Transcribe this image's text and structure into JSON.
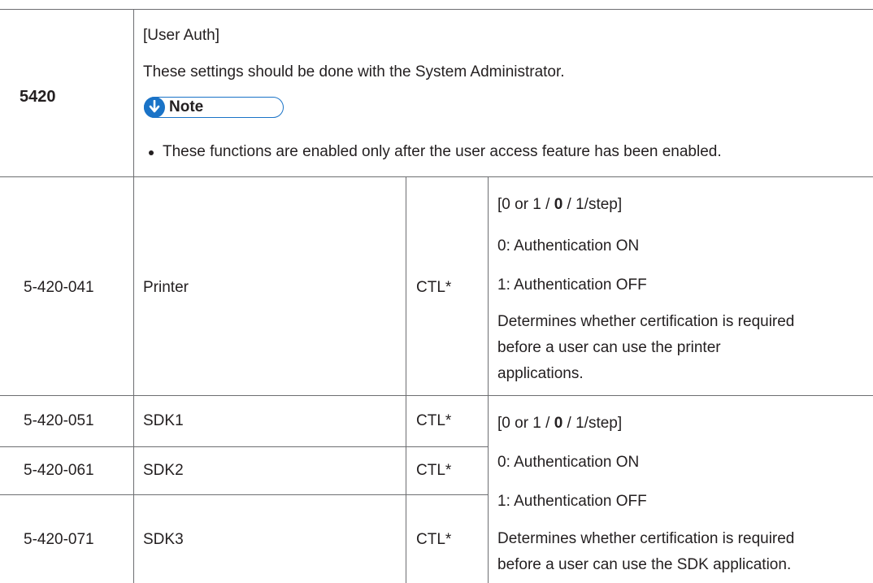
{
  "header": {
    "code": "5420",
    "title": "[User Auth]",
    "description": "These settings should be done with the System Administrator.",
    "note_label": "Note",
    "note_item": "These functions are enabled only after the user access feature has been enabled."
  },
  "rows": [
    {
      "code": "5-420-041",
      "name": "Printer",
      "type": "CTL*",
      "range_pre": "[0 or 1 / ",
      "range_default": "0",
      "range_post": " / 1/step]",
      "opt0": "0: Authentication ON",
      "opt1": "1: Authentication OFF",
      "desc_line1": "Determines whether certification is required",
      "desc_line2": "before a user can use the printer",
      "desc_line3": "applications."
    },
    {
      "code": "5-420-051",
      "name": "SDK1",
      "type": "CTL*"
    },
    {
      "code": "5-420-061",
      "name": "SDK2",
      "type": "CTL*"
    },
    {
      "code": "5-420-071",
      "name": "SDK3",
      "type": "CTL*"
    }
  ],
  "sdk_shared": {
    "range_pre": "[0 or 1 / ",
    "range_default": "0",
    "range_post": " / 1/step]",
    "opt0": "0: Authentication ON",
    "opt1": "1: Authentication OFF",
    "desc_line1": "Determines whether certification is required",
    "desc_line2": "before a user can use the SDK application."
  },
  "colors": {
    "rule": "#6d6e71",
    "note_accent": "#1a73c7",
    "text": "#231f20"
  }
}
